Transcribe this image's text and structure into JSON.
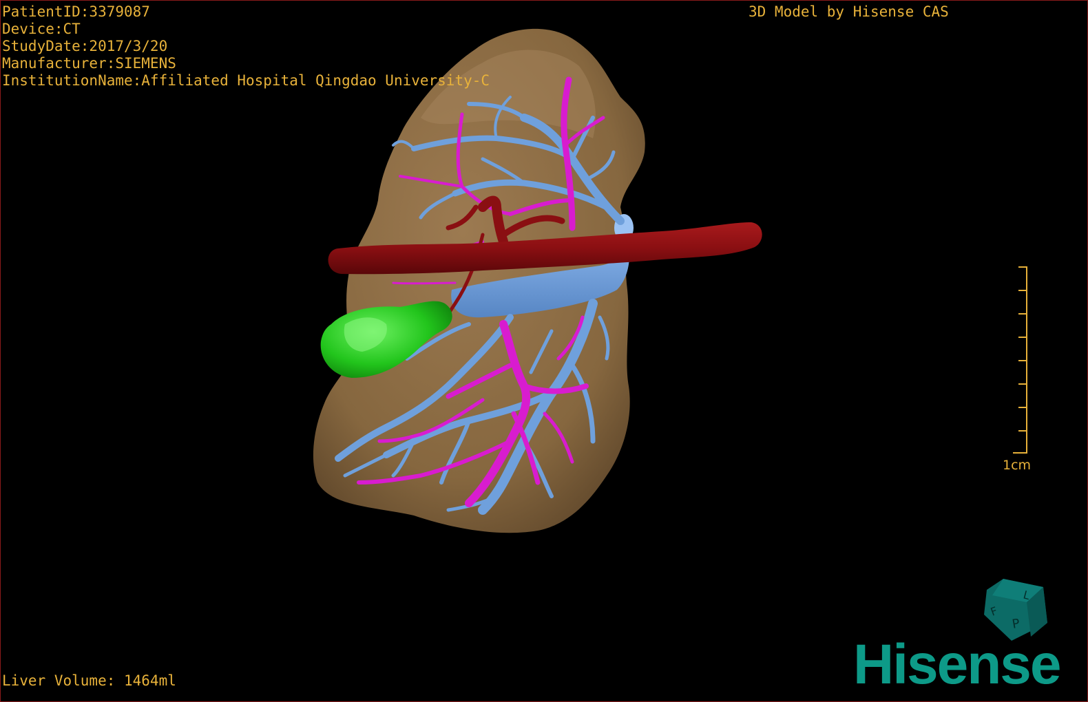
{
  "patient_info": {
    "patient_id": "PatientID:3379087",
    "device": "Device:CT",
    "study_date": "StudyDate:2017/3/20",
    "manufacturer": "Manufacturer:SIEMENS",
    "institution": "InstitutionName:Affiliated Hospital Qingdao University-C"
  },
  "caption": "3D Model by Hisense CAS",
  "liver_volume": "Liver Volume: 1464ml",
  "scale_bar": {
    "label": "1cm"
  },
  "orientation_cube": {
    "icon": "orientation-cube-icon",
    "face_letters": [
      "F",
      "L",
      "P"
    ]
  },
  "logo": {
    "text": "Hisense"
  },
  "colors": {
    "overlay_text": "#e8b23a",
    "liver": "#8a6a45",
    "portal_vein": "#6fa0dc",
    "hepatic_artery": "#d81ccf",
    "inferior_vena_cava": "#8a0f12",
    "gallbladder": "#22c51c",
    "brand": "#0d9a88"
  }
}
